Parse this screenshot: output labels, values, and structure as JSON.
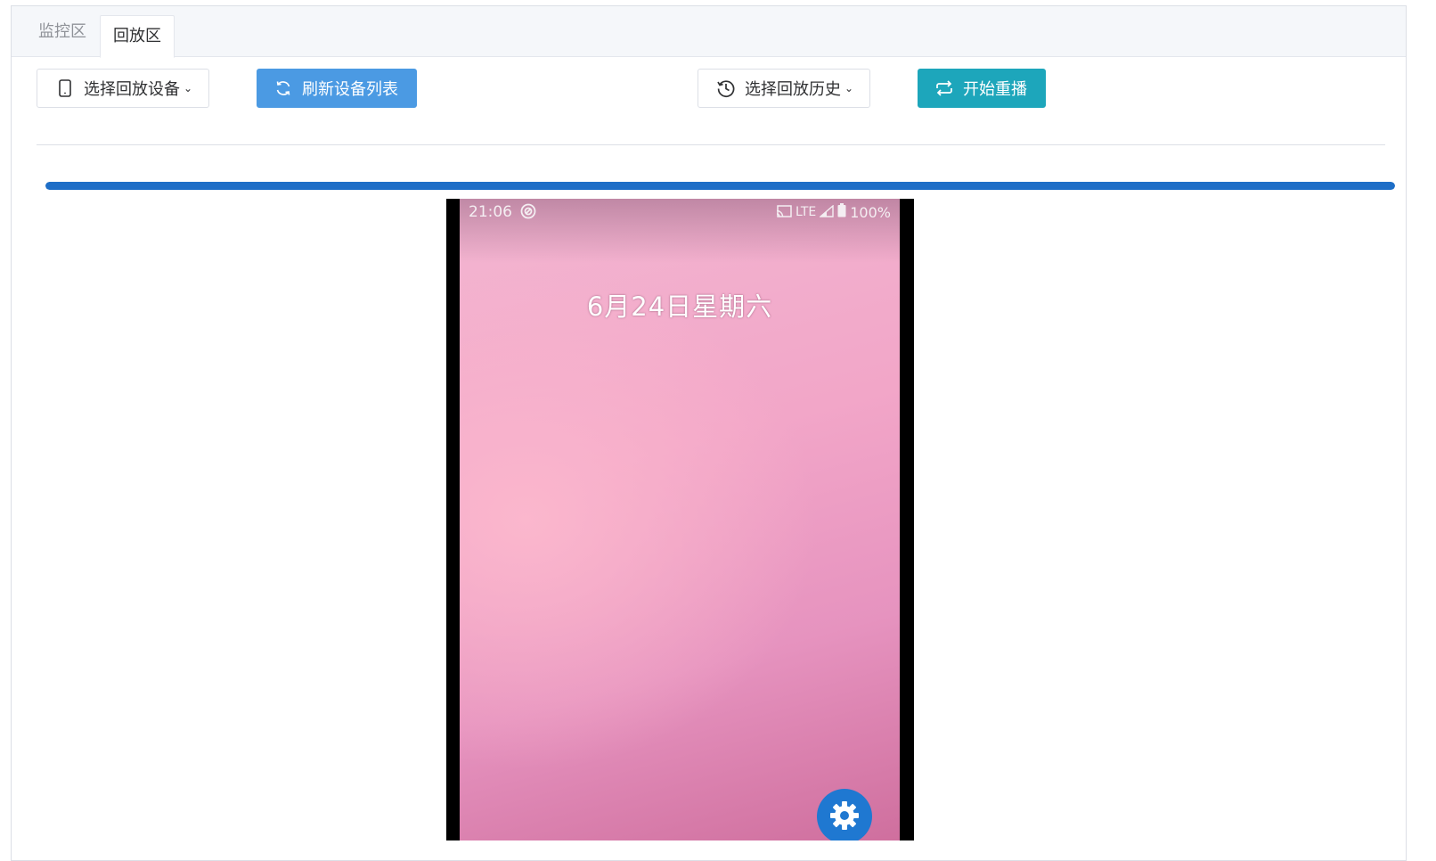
{
  "tabs": [
    {
      "label": "监控区",
      "active": false
    },
    {
      "label": "回放区",
      "active": true
    }
  ],
  "toolbar": {
    "select_device_label": "选择回放设备",
    "select_device_icon": "mobile-phone-icon",
    "refresh_label": "刷新设备列表",
    "refresh_icon": "refresh-icon",
    "select_history_label": "选择回放历史",
    "select_history_icon": "history-clock-icon",
    "start_replay_label": "开始重播",
    "start_replay_icon": "repeat-icon",
    "caret": "⌄"
  },
  "progress": {
    "value": 1.0,
    "color": "#1e6ec7"
  },
  "phone": {
    "status_time": "21:06",
    "status_network": "LTE",
    "status_battery": "100%",
    "lock_date": "6月24日星期六"
  },
  "colors": {
    "primary_blue": "#4b9ae3",
    "teal": "#1da6bb",
    "fab_blue": "#1f78d1"
  }
}
